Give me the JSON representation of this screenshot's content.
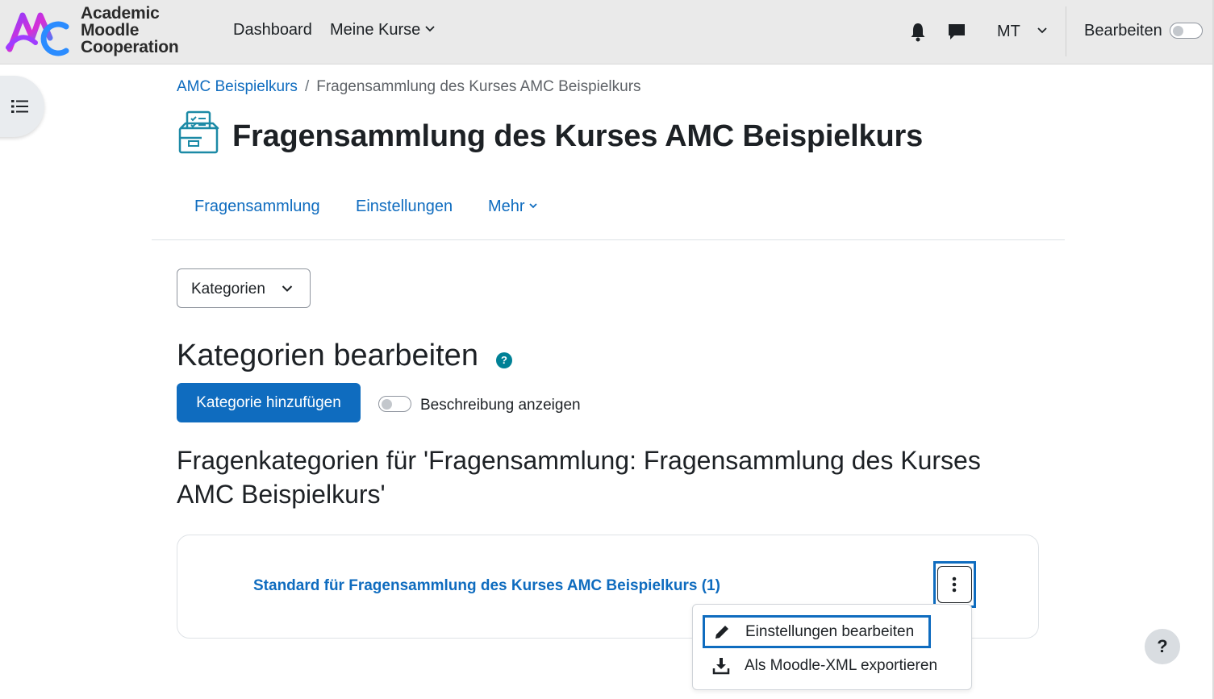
{
  "brand": {
    "line1": "Academic",
    "line2": "Moodle",
    "line3": "Cooperation",
    "colors": {
      "purple": "#8b3dff",
      "pink": "#d62fd6",
      "blue": "#2b8cff"
    }
  },
  "navbar": {
    "dashboard": "Dashboard",
    "my_courses": "Meine Kurse",
    "user_initials": "MT",
    "edit_mode_label": "Bearbeiten",
    "edit_mode_on": false
  },
  "breadcrumb": {
    "course": "AMC Beispielkurs",
    "separator": "/",
    "current": "Fragensammlung des Kurses AMC Beispielkurs"
  },
  "page": {
    "title": "Fragensammlung des Kurses AMC Beispielkurs"
  },
  "secondary_nav": {
    "tab1": "Fragensammlung",
    "tab2": "Einstellungen",
    "tab3": "Mehr"
  },
  "category_select": {
    "value": "Kategorien"
  },
  "section": {
    "heading": "Kategorien bearbeiten",
    "help": "?",
    "add_button": "Kategorie hinzufügen",
    "toggle_label": "Beschreibung anzeigen",
    "toggle_on": false,
    "subheading": "Fragenkategorien für 'Fragensammlung: Fragensammlung des Kurses AMC Beispielkurs'"
  },
  "category_card": {
    "link": "Standard für Fragensammlung des Kurses AMC Beispielkurs (1)"
  },
  "dropdown": {
    "edit_settings": "Einstellungen bearbeiten",
    "export_xml": "Als Moodle-XML exportieren"
  },
  "help_button": "?",
  "colors": {
    "accent": "#0f6cbf",
    "help_badge": "#008196",
    "navbar_bg": "#eaeaea"
  }
}
